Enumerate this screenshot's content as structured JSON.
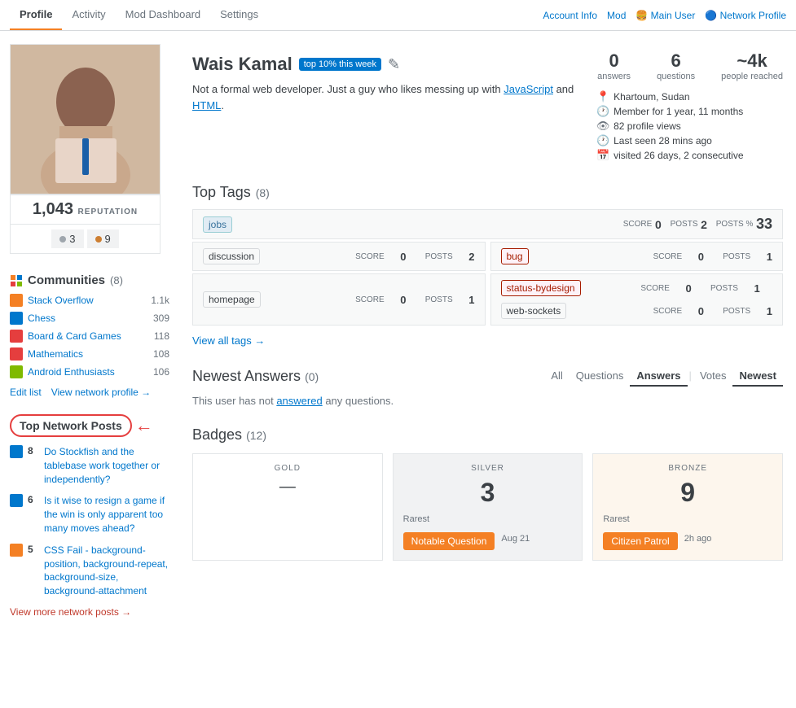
{
  "nav": {
    "tabs": [
      {
        "label": "Profile",
        "active": true
      },
      {
        "label": "Activity",
        "active": false
      },
      {
        "label": "Mod Dashboard",
        "active": false
      },
      {
        "label": "Settings",
        "active": false
      }
    ],
    "right_links": [
      {
        "label": "Account Info"
      },
      {
        "label": "Mod"
      },
      {
        "label": "🍔 Main User"
      },
      {
        "label": "🔵 Network Profile"
      }
    ]
  },
  "profile": {
    "name": "Wais Kamal",
    "top_pct_badge": "top 10% this week",
    "bio": "Not a formal web developer. Just a guy who likes messing up with JavaScript and HTML.",
    "bio_links": [
      "JavaScript",
      "HTML"
    ],
    "stats": {
      "answers": {
        "num": "0",
        "label": "answers"
      },
      "questions": {
        "num": "6",
        "label": "questions"
      },
      "people_reached": {
        "num": "~4k",
        "label": "people reached"
      }
    },
    "meta": [
      {
        "icon": "location",
        "text": "Khartoum, Sudan"
      },
      {
        "icon": "history",
        "text": "Member for 1 year, 11 months"
      },
      {
        "icon": "eye",
        "text": "82 profile views"
      },
      {
        "icon": "clock",
        "text": "Last seen 28 mins ago"
      },
      {
        "icon": "calendar",
        "text": "visited 26 days, 2 consecutive"
      }
    ],
    "reputation": "1,043",
    "rep_label": "REPUTATION",
    "badges": {
      "silver": {
        "count": "3",
        "dot_class": "silver"
      },
      "bronze": {
        "count": "9",
        "dot_class": "bronze"
      }
    }
  },
  "communities": {
    "title": "Communities",
    "count": "(8)",
    "items": [
      {
        "name": "Stack Overflow",
        "count": "1.1k",
        "color": "#f48024"
      },
      {
        "name": "Chess",
        "count": "309",
        "color": "#0077cc"
      },
      {
        "name": "Board & Card Games",
        "count": "118",
        "color": "#e53e3e"
      },
      {
        "name": "Mathematics",
        "count": "108",
        "color": "#e53e3e"
      },
      {
        "name": "Android Enthusiasts",
        "count": "106",
        "color": "#7fba00"
      }
    ],
    "edit_list": "Edit list",
    "view_network": "View network profile →"
  },
  "top_network": {
    "title": "Top Network Posts",
    "posts": [
      {
        "score": 8,
        "text": "Do Stockfish and the tablebase work together or independently?",
        "icon_color": "#0077cc"
      },
      {
        "score": 6,
        "text": "Is it wise to resign a game if the win is only apparent too many moves ahead?",
        "icon_color": "#0077cc"
      },
      {
        "score": 5,
        "text": "CSS Fail - background-position, background-repeat, background-size, background-attachment",
        "icon_color": "#f48024"
      }
    ],
    "view_more": "View more network posts →"
  },
  "top_tags": {
    "title": "Top Tags",
    "count": "(8)",
    "rows": [
      {
        "type": "full",
        "tag": "jobs",
        "score_label": "SCORE",
        "score": "0",
        "posts_label": "POSTS",
        "posts": "2",
        "postspct_label": "POSTS %",
        "postspct": "33"
      },
      {
        "type": "half",
        "left": {
          "tag": "discussion",
          "tag_style": "plain",
          "score_label": "SCORE",
          "score": "0",
          "posts_label": "POSTS",
          "posts": "2"
        },
        "right": {
          "tag": "bug",
          "tag_style": "red",
          "score_label": "SCORE",
          "score": "0",
          "posts_label": "POSTS",
          "posts": "1"
        }
      },
      {
        "type": "half",
        "left": {
          "tag": "homepage",
          "tag_style": "plain",
          "score_label": "SCORE",
          "score": "0",
          "posts_label": "POSTS",
          "posts": "1"
        },
        "right_left": {
          "tag": "status-bydesign",
          "tag_style": "red",
          "score_label": "SCORE",
          "score": "0",
          "posts_label": "POSTS",
          "posts": "1"
        },
        "right_right": {
          "tag": "web-sockets",
          "tag_style": "plain",
          "score_label": "SCORE",
          "score": "0",
          "posts_label": "POSTS",
          "posts": "1"
        }
      }
    ],
    "view_all": "View all tags →"
  },
  "newest_answers": {
    "title": "Newest Answers",
    "count": "(0)",
    "filter_tabs": [
      "All",
      "Questions",
      "Answers",
      "Votes",
      "Newest"
    ],
    "active_tab": "Answers",
    "empty_message": "This user has not answered any questions.",
    "answered_link_text": "answered"
  },
  "badges_section": {
    "title": "Badges",
    "count": "(12)",
    "gold": {
      "label": "GOLD",
      "value": "—"
    },
    "silver": {
      "label": "SILVER",
      "value": "3"
    },
    "bronze": {
      "label": "BRONZE",
      "value": "9"
    },
    "rarest_label": "Rarest",
    "silver_badge_name": "Notable Question",
    "silver_badge_date": "Aug 21",
    "bronze_badge_name": "Citizen Patrol",
    "bronze_badge_date": "2h ago"
  }
}
